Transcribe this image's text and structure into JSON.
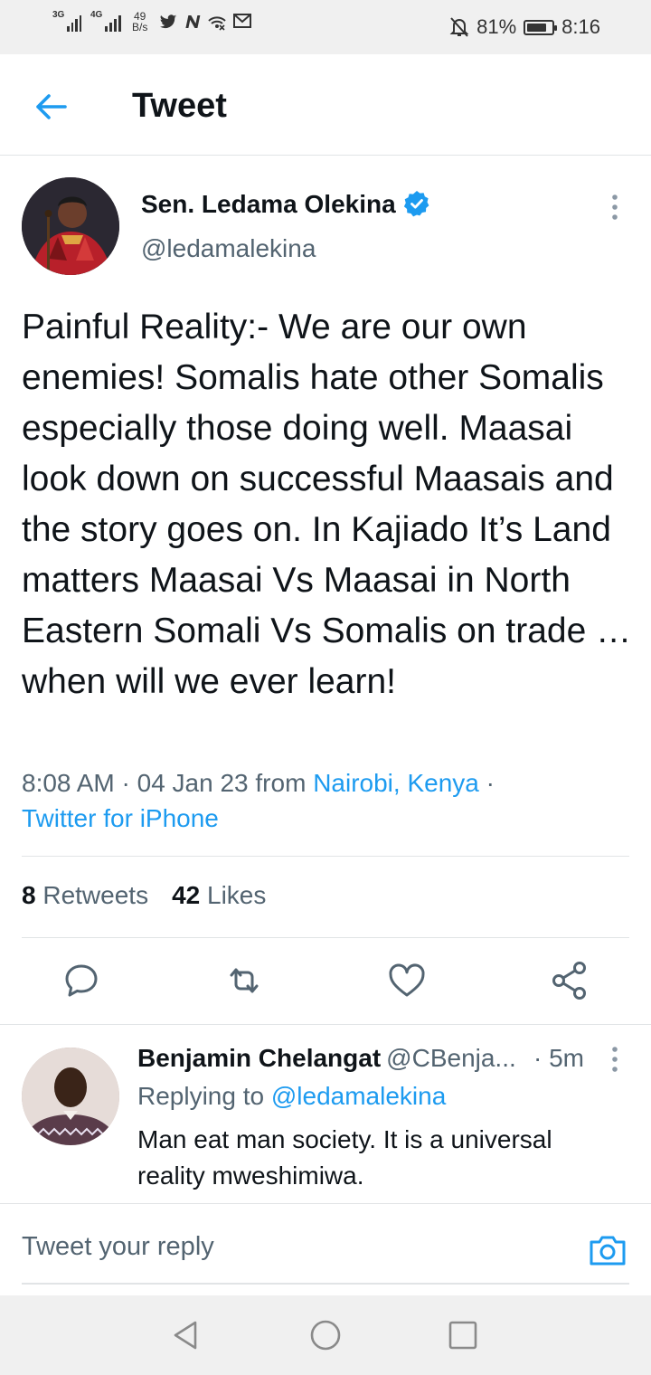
{
  "status_bar": {
    "network_1": "3G",
    "network_2": "4G",
    "net_speed_value": "49",
    "net_speed_unit": "B/s",
    "app_icons": [
      "twitter-icon",
      "n-app-icon",
      "mobile-data-icon",
      "gmail-icon"
    ],
    "battery_percent": "81%",
    "battery_level": 0.81,
    "time": "8:16"
  },
  "header": {
    "title": "Tweet"
  },
  "tweet": {
    "author_name": "Sen. Ledama Olekina",
    "author_handle": "@ledamalekina",
    "text": "Painful Reality:- We are our own enemies! Somalis hate other Somalis especially those doing well. Maasai look down on successful Maasais and the story goes on. In Kajiado It’s Land matters Maasai Vs Maasai in North Eastern Somali Vs Somalis on trade … when will we ever learn!",
    "time": "8:08 AM",
    "date_sep": " · ",
    "date": "04 Jan 23",
    "from_label": " from ",
    "location": "Nairobi, Kenya",
    "source_sep": " · ",
    "source": "Twitter for iPhone",
    "retweets_count": "8",
    "retweets_label": "Retweets",
    "likes_count": "42",
    "likes_label": "Likes"
  },
  "reply": {
    "author_name": "Benjamin Chelangat",
    "author_handle": "@CBenja...",
    "time": "· 5m",
    "replying_label": "Replying to ",
    "replying_to": "@ledamalekina",
    "text": "Man eat man society. It is a universal reality mweshimiwa."
  },
  "composer": {
    "placeholder": "Tweet your reply"
  },
  "colors": {
    "accent": "#1d9bf0",
    "secondary_text": "#536471",
    "primary_text": "#0f1419",
    "divider": "#e1e4e6",
    "system_bar": "#f0f0f0"
  }
}
